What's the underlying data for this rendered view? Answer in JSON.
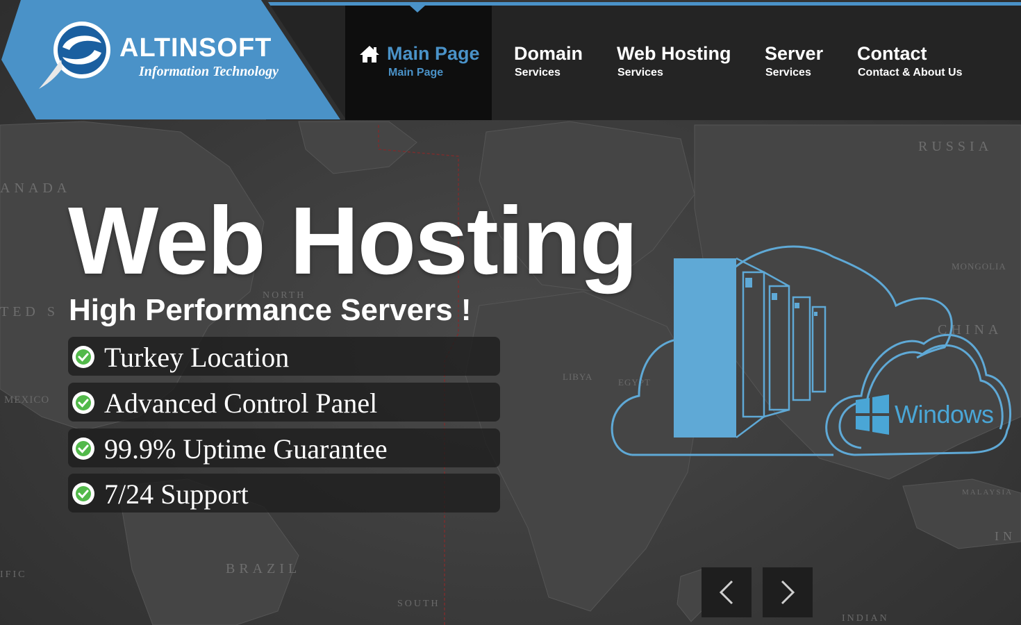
{
  "brand": {
    "name": "ALTINSOFT",
    "tagline": "Information Technology",
    "color": "#4a92c8"
  },
  "nav": {
    "items": [
      {
        "title": "Main Page",
        "sub": "Main Page",
        "active": true,
        "icon": "home-icon"
      },
      {
        "title": "Domain",
        "sub": "Services",
        "active": false
      },
      {
        "title": "Web Hosting",
        "sub": "Services",
        "active": false
      },
      {
        "title": "Server",
        "sub": "Services",
        "active": false
      },
      {
        "title": "Contact",
        "sub": "Contact & About Us",
        "active": false
      }
    ]
  },
  "hero": {
    "title": "Web Hosting",
    "subtitle": "High Performance Servers !",
    "features": [
      {
        "text": "Turkey Location",
        "icon": "check-circle-icon"
      },
      {
        "text": "Advanced Control Panel",
        "icon": "check-circle-icon"
      },
      {
        "text": "99.9% Uptime Guarantee",
        "icon": "check-circle-icon"
      },
      {
        "text": "7/24 Support",
        "icon": "check-circle-icon"
      }
    ],
    "artwork_label": "Windows"
  },
  "map_labels": {
    "russia": "RUSSIA",
    "canada": "ANADA",
    "united_states": "TED S",
    "china": "CHINA",
    "brazil": "BRAZIL",
    "mexico": "MEXICO",
    "mongolia": "MONGOLIA",
    "libya": "LIBYA",
    "egypt": "EGYPT",
    "north": "NORTH",
    "south": "SOUTH",
    "indian": "INDIAN",
    "pacific": "IFIC",
    "malaysia": "MALAYSIA",
    "in": "IN"
  },
  "slider": {
    "prev_icon": "chevron-left-icon",
    "next_icon": "chevron-right-icon"
  }
}
